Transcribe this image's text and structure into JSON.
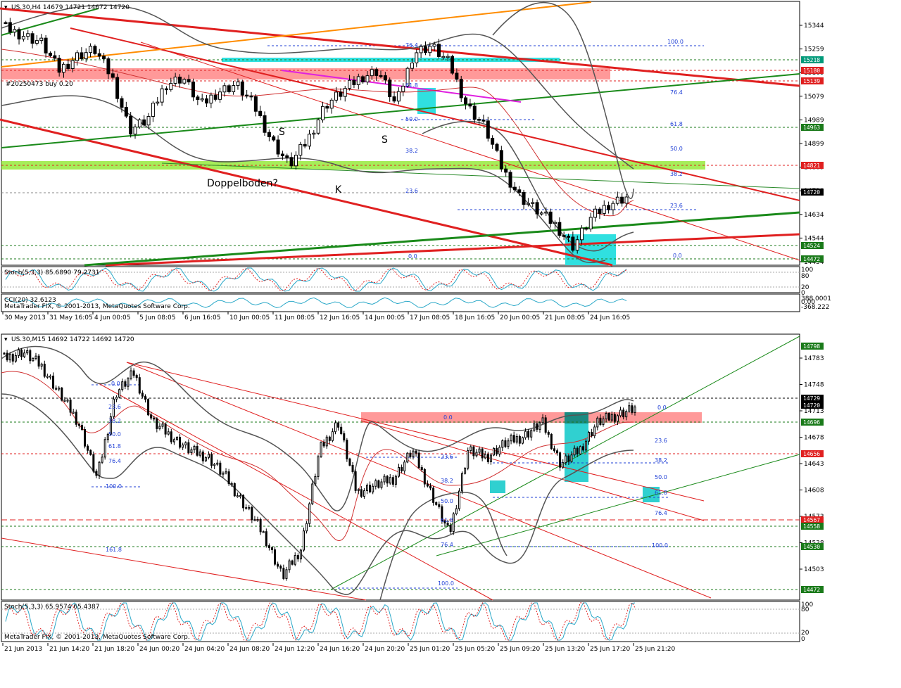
{
  "chart_data": [
    {
      "type": "candlestick",
      "symbol_header": "US.30,H4  14679 14721 14672 14720",
      "y_ticks": [
        "15344",
        "15259",
        "15169",
        "15079",
        "14989",
        "14899",
        "14809",
        "14720",
        "14634",
        "14544",
        "14454"
      ],
      "price_labels": [
        {
          "text": "15218",
          "color": "#009a7a"
        },
        {
          "text": "15180",
          "color": "#e02020"
        },
        {
          "text": "15139",
          "color": "#e02020"
        },
        {
          "text": "14963",
          "color": "#1a7a1a"
        },
        {
          "text": "14821",
          "color": "#e02020"
        },
        {
          "text": "14720",
          "color": "#000000"
        },
        {
          "text": "14524",
          "color": "#1a7a1a"
        },
        {
          "text": "14472",
          "color": "#1a7a1a"
        }
      ],
      "fib_left": [
        "76.4",
        "61.8",
        "50.0",
        "38.2",
        "23.6",
        "0.0"
      ],
      "fib_right": [
        "100.0",
        "76.4",
        "61.8",
        "50.0",
        "38.2",
        "23.6",
        "0.0"
      ],
      "annotations": [
        "S",
        "S",
        "K",
        "Doppelboden?",
        "#20250473 buy 0.20"
      ],
      "indicator1": "Stoch(5,3,3) 85.6890 79.2731",
      "indicator1_ticks": [
        "100",
        "80",
        "20",
        "0"
      ],
      "indicator2": "CCI(20) 32.6123",
      "indicator2_ticks": [
        "388.0001",
        "0.00",
        "-368.222"
      ],
      "copyright": "MetaTrader FIX, © 2001-2013, MetaQuotes Software Corp.",
      "x_labels": [
        "30 May 2013",
        "31 May 16:05",
        "4 Jun 00:05",
        "5 Jun 08:05",
        "6 Jun 16:05",
        "10 Jun 00:05",
        "11 Jun 08:05",
        "12 Jun 16:05",
        "14 Jun 00:05",
        "17 Jun 08:05",
        "18 Jun 16:05",
        "20 Jun 00:05",
        "21 Jun 08:05",
        "24 Jun 16:05"
      ]
    },
    {
      "type": "candlestick",
      "symbol_header": "US.30,M15  14692 14722 14692 14720",
      "y_ticks": [
        "14783",
        "14748",
        "14713",
        "14678",
        "14643",
        "14608",
        "14573",
        "14538",
        "14503"
      ],
      "price_labels": [
        {
          "text": "14798",
          "color": "#1a7a1a"
        },
        {
          "text": "14729",
          "color": "#000000"
        },
        {
          "text": "14720",
          "color": "#000000"
        },
        {
          "text": "14696",
          "color": "#1a7a1a"
        },
        {
          "text": "14656",
          "color": "#e02020"
        },
        {
          "text": "14567",
          "color": "#e02020"
        },
        {
          "text": "14558",
          "color": "#1a7a1a"
        },
        {
          "text": "14530",
          "color": "#1a7a1a"
        },
        {
          "text": "14472",
          "color": "#1a7a1a"
        }
      ],
      "fib_a": [
        "0.0",
        "23.6",
        "38.2",
        "50.0",
        "61.8",
        "76.4",
        "100.0",
        "161.8"
      ],
      "fib_b": [
        "0.0",
        "23.6",
        "38.2",
        "50.0",
        "61.8",
        "76.4",
        "100.0"
      ],
      "fib_c": [
        "0.0",
        "23.6",
        "38.2",
        "50.0",
        "61.8",
        "76.4",
        "100.0"
      ],
      "indicator1": "Stoch(5,3,3) 65.9574 65.4387",
      "indicator1_ticks": [
        "100",
        "80",
        "20",
        "0"
      ],
      "copyright": "MetaTrader FIX, © 2001-2013, MetaQuotes Software Corp.",
      "x_labels": [
        "21 Jun 2013",
        "21 Jun 14:20",
        "21 Jun 18:20",
        "24 Jun 00:20",
        "24 Jun 04:20",
        "24 Jun 08:20",
        "24 Jun 12:20",
        "24 Jun 16:20",
        "24 Jun 20:20",
        "25 Jun 01:20",
        "25 Jun 05:20",
        "25 Jun 09:20",
        "25 Jun 13:20",
        "25 Jun 17:20",
        "25 Jun 21:20"
      ]
    }
  ]
}
